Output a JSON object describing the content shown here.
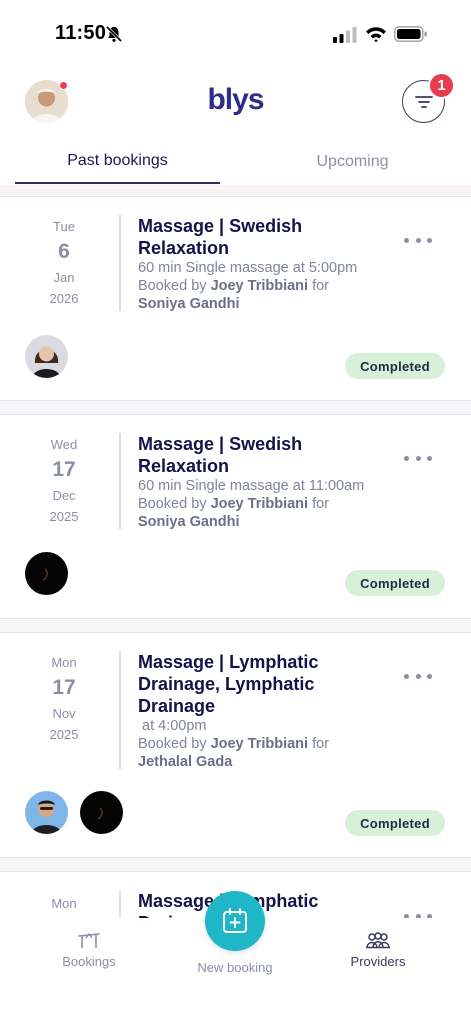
{
  "status_bar": {
    "time": "11:50"
  },
  "header": {
    "logo": "blys",
    "filter_badge_count": "1"
  },
  "tabs": [
    {
      "label": "Past bookings",
      "active": true
    },
    {
      "label": "Upcoming",
      "active": false
    }
  ],
  "bookings": [
    {
      "day": "Tue",
      "date": "6",
      "month": "Jan",
      "year": "2026",
      "title": "Massage | Swedish Relaxation",
      "detail": "60 min Single massage at 5:00pm",
      "booked_by_prefix": "Booked by",
      "booked_by": "Joey Tribbiani",
      "for_word": "for",
      "recipient": "Soniya Gandhi",
      "status": "Completed",
      "providers": [
        "avatar-woman"
      ]
    },
    {
      "day": "Wed",
      "date": "17",
      "month": "Dec",
      "year": "2025",
      "title": "Massage | Swedish Relaxation",
      "detail": "60 min Single massage at 11:00am",
      "booked_by_prefix": "Booked by",
      "booked_by": "Joey Tribbiani",
      "for_word": "for",
      "recipient": "Soniya Gandhi",
      "status": "Completed",
      "providers": [
        "avatar-dark"
      ]
    },
    {
      "day": "Mon",
      "date": "17",
      "month": "Nov",
      "year": "2025",
      "title": "Massage | Lymphatic Drainage, Lymphatic Drainage",
      "detail": " at 4:00pm",
      "booked_by_prefix": "Booked by",
      "booked_by": "Joey Tribbiani",
      "for_word": "for",
      "recipient": "Jethalal Gada",
      "status": "Completed",
      "providers": [
        "avatar-man",
        "avatar-dark"
      ]
    },
    {
      "day": "Mon",
      "title": "Massage | Lymphatic Drainage"
    }
  ],
  "bottom_nav": {
    "bookings": "Bookings",
    "new_booking": "New booking",
    "providers": "Providers"
  },
  "colors": {
    "brand": "#2d2d8c",
    "accent_fab": "#1fb6c8",
    "badge_red": "#e63d4f",
    "status_completed_bg": "#d9f0d8"
  }
}
